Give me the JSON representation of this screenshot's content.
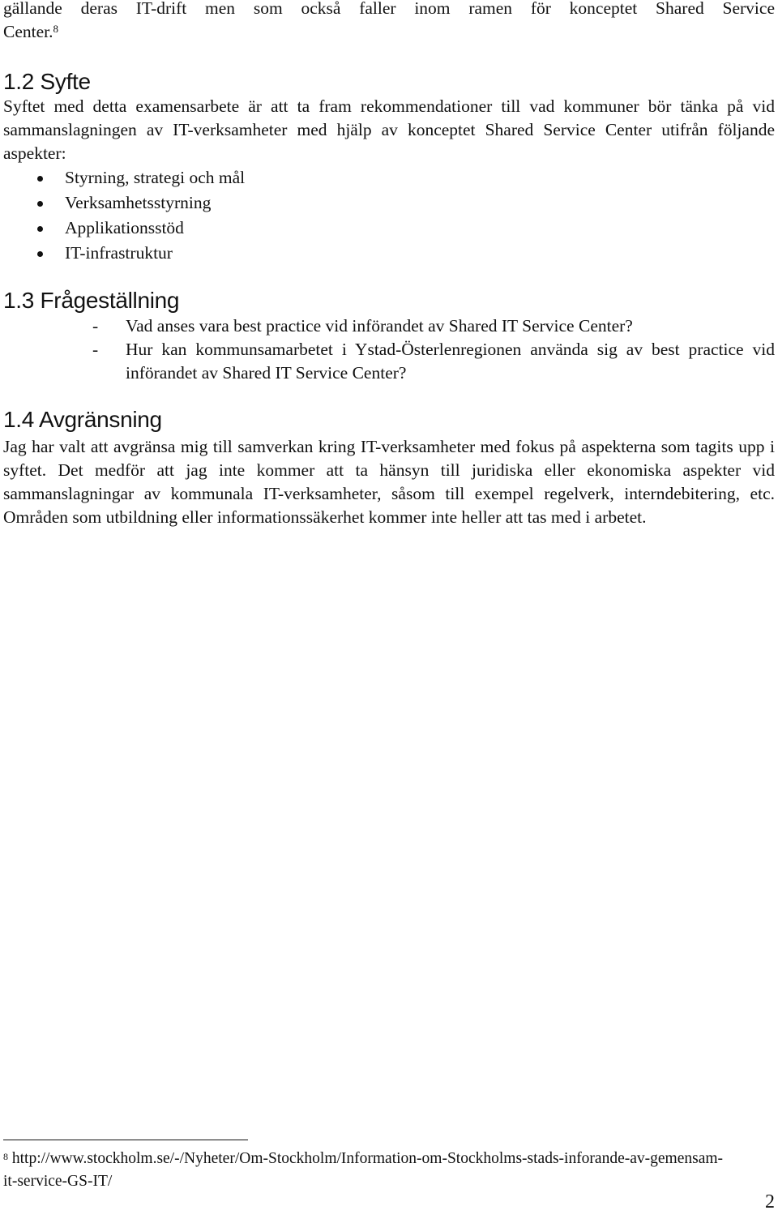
{
  "intro": {
    "text": "gällande deras IT-drift men som också faller inom ramen för konceptet Shared Service",
    "text_end": "Center.",
    "footnote_ref": "8"
  },
  "sections": [
    {
      "heading": "1.2 Syfte",
      "paragraph": "Syftet med detta examensarbete är att ta fram rekommendationer till vad kommuner bör tänka på vid sammanslagningen av IT-verksamheter med hjälp av konceptet Shared Service Center utifrån följande aspekter:",
      "bullets": [
        "Styrning, strategi och mål",
        "Verksamhetsstyrning",
        "Applikationsstöd",
        "IT-infrastruktur"
      ]
    },
    {
      "heading": "1.3 Frågeställning",
      "dash_items": [
        "Vad anses vara best practice vid införandet av Shared IT Service Center?",
        "Hur kan kommunsamarbetet i Ystad-Österlenregionen använda sig av best practice vid införandet av Shared IT Service Center?"
      ]
    },
    {
      "heading": "1.4 Avgränsning",
      "paragraph": "Jag har valt att avgränsa mig till samverkan kring IT-verksamheter med fokus på aspekterna som tagits upp i syftet. Det medför att jag inte kommer att ta hänsyn till juridiska eller ekonomiska aspekter vid sammanslagningar av kommunala IT-verksamheter, såsom till exempel regelverk, interndebitering, etc. Områden som utbildning eller informationssäkerhet kommer inte heller att tas med i arbetet."
    }
  ],
  "footnote": {
    "marker": "8",
    "text": "http://www.stockholm.se/-/Nyheter/Om-Stockholm/Information-om-Stockholms-stads-inforande-av-gemensam-it-service-GS-IT/"
  },
  "page_number": "2"
}
